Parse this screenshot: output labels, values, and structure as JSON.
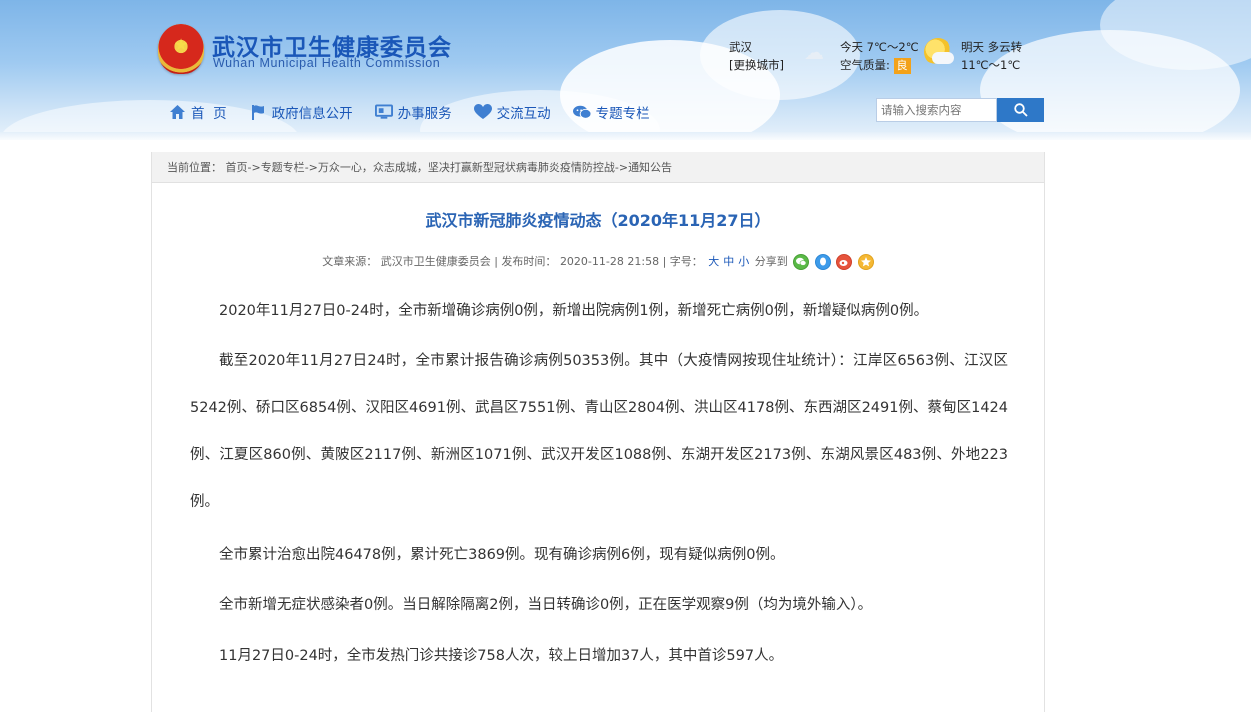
{
  "header": {
    "site_name": "武汉市卫生健康委员会",
    "site_name_en": "Wuhan Municipal Health Commission",
    "city": "武汉",
    "change_city": "[更换城市]",
    "today_weather": "今天 7℃～2℃",
    "air_quality_label": "空气质量:",
    "air_quality_value": "良",
    "tomorrow_weather": "明天  多云转",
    "tomorrow_temp": "11℃～1℃"
  },
  "nav": {
    "items": [
      {
        "label": "首  页",
        "icon": "home-icon"
      },
      {
        "label": "政府信息公开",
        "icon": "flag-icon"
      },
      {
        "label": "办事服务",
        "icon": "monitor-icon"
      },
      {
        "label": "交流互动",
        "icon": "heart-icon"
      },
      {
        "label": "专题专栏",
        "icon": "chat-icon"
      }
    ],
    "search_placeholder": "请输入搜索内容"
  },
  "breadcrumb": {
    "label": "当前位置：",
    "path": [
      "首页",
      "专题专栏",
      "万众一心，众志成城，坚决打赢新型冠状病毒肺炎疫情防控战",
      "通知公告"
    ],
    "separator": "->"
  },
  "article": {
    "title": "武汉市新冠肺炎疫情动态（2020年11月27日）",
    "source_label": "文章来源：",
    "source": "武汉市卫生健康委员会",
    "publish_label": "| 发布时间：",
    "publish_time": "2020-11-28 21:58",
    "font_label": "| 字号：",
    "font_large": "大",
    "font_medium": "中",
    "font_small": "小",
    "share_label": "分享到",
    "paragraphs": [
      "2020年11月27日0-24时，全市新增确诊病例0例，新增出院病例1例，新增死亡病例0例，新增疑似病例0例。",
      "截至2020年11月27日24时，全市累计报告确诊病例50353例。其中（大疫情网按现住址统计）：江岸区6563例、江汉区5242例、硚口区6854例、汉阳区4691例、武昌区7551例、青山区2804例、洪山区4178例、东西湖区2491例、蔡甸区1424例、江夏区860例、黄陂区2117例、新洲区1071例、武汉开发区1088例、东湖开发区2173例、东湖风景区483例、外地223例。",
      "全市累计治愈出院46478例，累计死亡3869例。现有确诊病例6例，现有疑似病例0例。",
      "全市新增无症状感染者0例。当日解除隔离2例，当日转确诊0例，正在医学观察9例（均为境外输入）。",
      "11月27日0-24时，全市发热门诊共接诊758人次，较上日增加37人，其中首诊597人。"
    ]
  },
  "colors": {
    "brand_blue": "#1a57b8",
    "title_blue": "#2a64b4",
    "search_button": "#2e78c8",
    "air_quality_badge": "#f3a21a"
  }
}
